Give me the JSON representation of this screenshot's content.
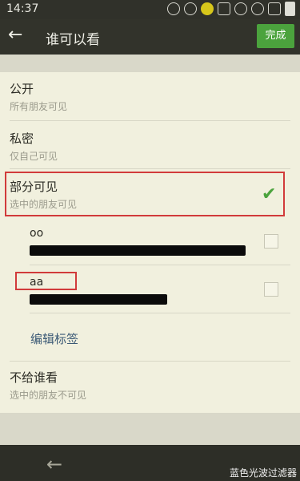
{
  "status": {
    "time": "14:37",
    "icons": [
      "message-icon",
      "sticker-icon",
      "yellow-app-icon",
      "image-icon",
      "alarm-icon",
      "wifi-icon",
      "signal-icon",
      "battery-icon"
    ]
  },
  "header": {
    "title": "谁可以看",
    "done_label": "完成"
  },
  "options": {
    "public": {
      "title": "公开",
      "subtitle": "所有朋友可见"
    },
    "private": {
      "title": "私密",
      "subtitle": "仅自己可见"
    },
    "partial": {
      "title": "部分可见",
      "subtitle": "选中的朋友可见",
      "selected": true
    },
    "exclude": {
      "title": "不给谁看",
      "subtitle": "选中的朋友不可见"
    }
  },
  "friends": [
    {
      "name": "oo",
      "checked": false
    },
    {
      "name": "aa",
      "checked": false
    }
  ],
  "edit_tag_label": "编辑标签",
  "watermark": "蓝色光波过滤器",
  "colors": {
    "accent": "#4ba33d",
    "highlight": "#d13b3b",
    "link": "#3c5a76"
  }
}
